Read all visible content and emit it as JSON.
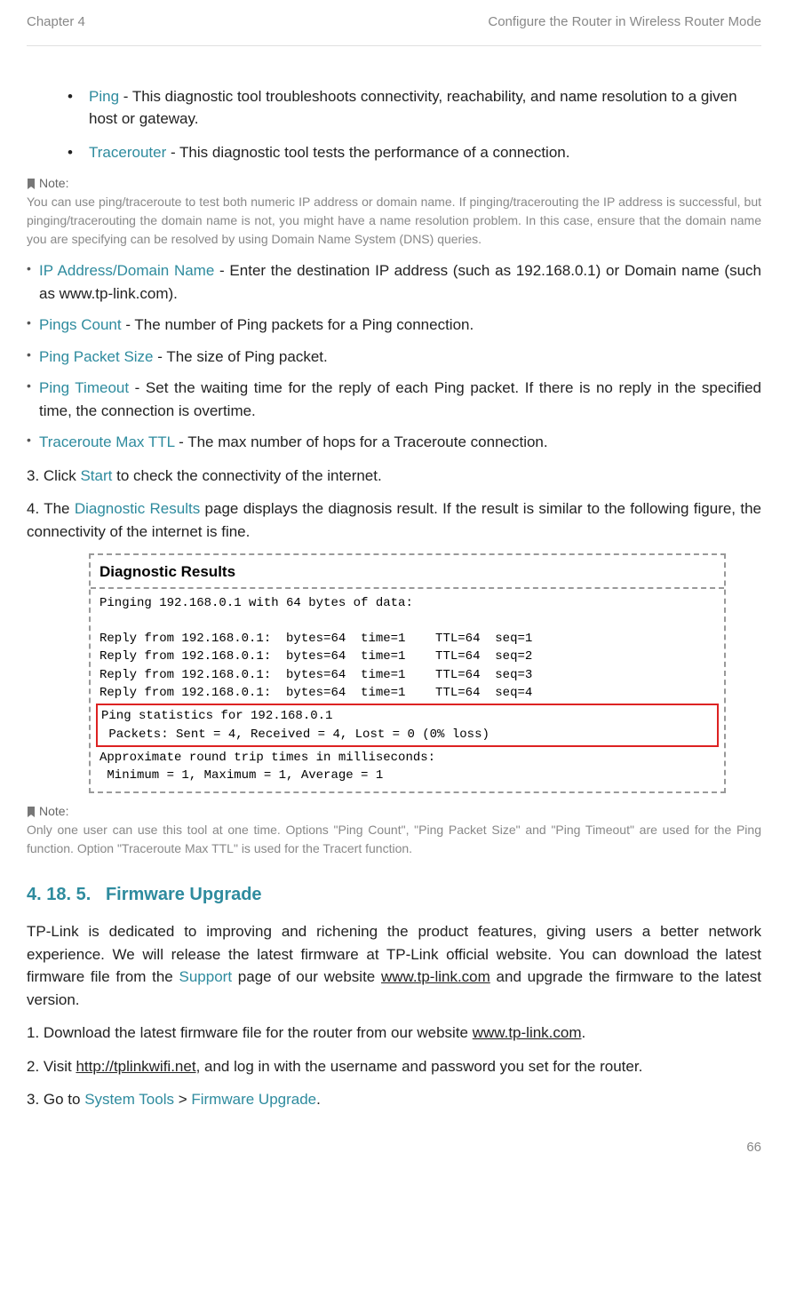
{
  "header": {
    "chapter": "Chapter 4",
    "title": "Configure the Router in Wireless Router Mode"
  },
  "tools": {
    "ping_term": "Ping",
    "ping_desc": " - This diagnostic tool troubleshoots connectivity, reachability, and name resolution to a given host or gateway.",
    "tracer_term": "Tracerouter",
    "tracer_desc": " - This diagnostic tool tests the performance of a connection."
  },
  "note1": {
    "label": "Note:",
    "text": "You can use ping/traceroute to test both numeric IP address or domain name. If pinging/tracerouting the IP address is successful, but pinging/tracerouting the domain name is not, you might have a name resolution problem. In this case, ensure that the domain name you are specifying can be resolved by using Domain Name System (DNS) queries."
  },
  "params": {
    "ipaddr_term": "IP Address/Domain Name",
    "ipaddr_desc": " - Enter the destination IP address (such as 192.168.0.1) or Domain name (such as www.tp-link.com).",
    "pingscount_term": "Pings Count",
    "pingscount_desc": " - The number of Ping packets for a Ping connection.",
    "pingsize_term": "Ping Packet Size",
    "pingsize_desc": " - The size of Ping packet.",
    "pingtimeout_term": "Ping Timeout",
    "pingtimeout_desc": " - Set the waiting time for the reply of each Ping packet. If there is no reply in the specified time, the connection is overtime.",
    "ttl_term": "Traceroute Max TTL",
    "ttl_desc": " - The max number of hops for a Traceroute connection."
  },
  "steps1": {
    "s3a": "3. Click ",
    "s3_term": "Start",
    "s3b": " to check the connectivity of the internet.",
    "s4a": "4. The ",
    "s4_term": "Diagnostic Results",
    "s4b": " page displays the diagnosis result. If the result is similar to the following figure, the connectivity of the internet is fine."
  },
  "diag": {
    "title": "Diagnostic Results",
    "line_ping": "Pinging 192.168.0.1 with 64 bytes of data:",
    "r1": "Reply from 192.168.0.1:  bytes=64  time=1    TTL=64  seq=1",
    "r2": "Reply from 192.168.0.1:  bytes=64  time=1    TTL=64  seq=2",
    "r3": "Reply from 192.168.0.1:  bytes=64  time=1    TTL=64  seq=3",
    "r4": "Reply from 192.168.0.1:  bytes=64  time=1    TTL=64  seq=4",
    "stats1": "Ping statistics for 192.168.0.1",
    "stats2": " Packets: Sent = 4, Received = 4, Lost = 0 (0% loss)",
    "rt1": "Approximate round trip times in milliseconds:",
    "rt2": " Minimum = 1, Maximum = 1, Average = 1"
  },
  "note2": {
    "label": "Note:",
    "text": "Only one user can use this tool at one time. Options \"Ping Count\", \"Ping Packet Size\" and \"Ping Timeout\" are used for the Ping function. Option \"Traceroute Max TTL\" is used for the Tracert function."
  },
  "section": {
    "num": "4. 18. 5.",
    "title": "Firmware Upgrade"
  },
  "firmware": {
    "p1a": "TP-Link is dedicated to improving and richening the product features, giving users a better network experience. We will release the latest firmware at TP-Link official website. You can download the latest firmware file from the ",
    "p1_term": "Support",
    "p1b": " page of our website ",
    "p1_link": "www.tp-link.com",
    "p1c": " and upgrade the firmware to the latest version."
  },
  "steps2": {
    "s1a": "1. Download the latest firmware file for the router from our website ",
    "s1_link": "www.tp-link.com",
    "s1b": ".",
    "s2a": "2. Visit ",
    "s2_link": "http://tplinkwifi.net",
    "s2b": ", and log in with the username and password you set for the router.",
    "s3a": "3. Go to ",
    "s3_term1": "System Tools",
    "s3_gt": " > ",
    "s3_term2": "Firmware Upgrade",
    "s3b": "."
  },
  "pagenum": "66"
}
